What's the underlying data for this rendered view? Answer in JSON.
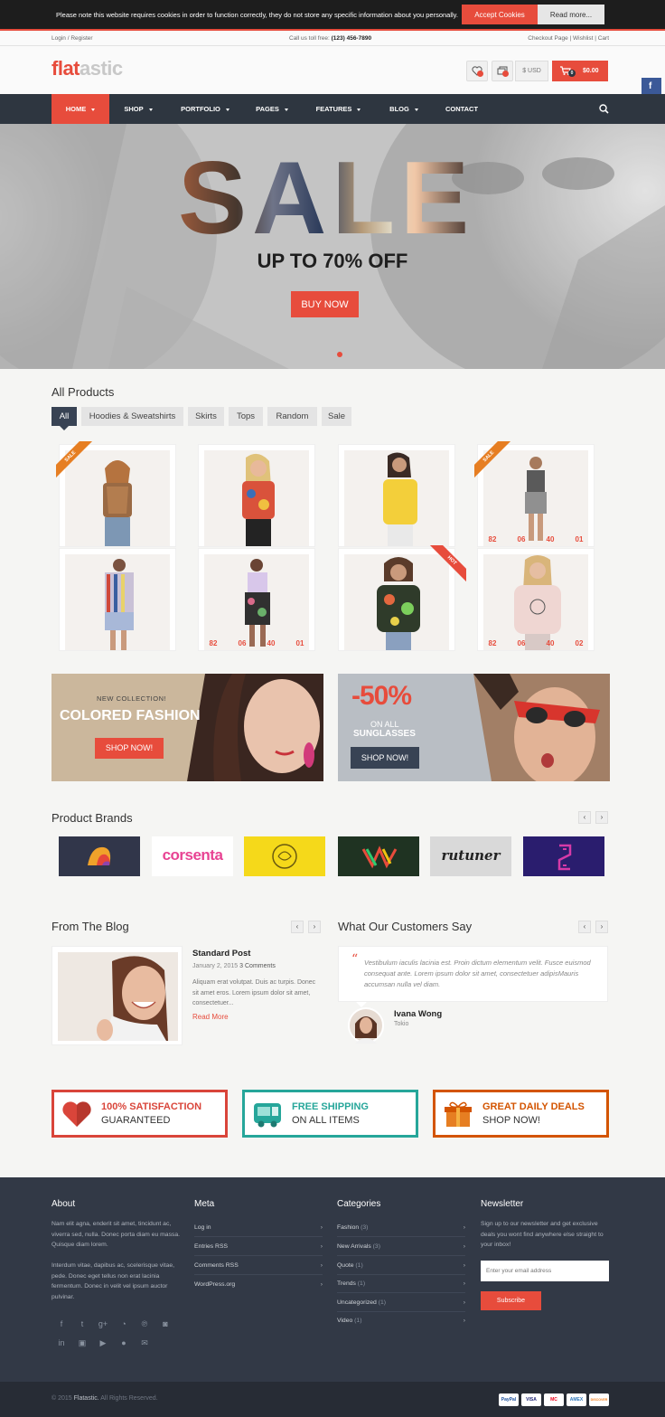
{
  "cookie": {
    "message": "Please note this website requires cookies in order to function correctly, they do not store any specific information about you personally.",
    "accept": "Accept Cookies",
    "read_more": "Read more..."
  },
  "topbar": {
    "login": "Login / Register",
    "call_label": "Call us toll free:",
    "phone": "(123) 456-7890",
    "links": "Checkout Page  |  Wishlist  |  Cart"
  },
  "header": {
    "logo_a": "flat",
    "logo_b": "astic",
    "currency": "$ USD",
    "cart_total": "$0.00",
    "cart_count": "0"
  },
  "nav": {
    "items": [
      "HOME",
      "SHOP",
      "PORTFOLIO",
      "PAGES",
      "FEATURES",
      "BLOG",
      "CONTACT"
    ]
  },
  "hero": {
    "title": "SALE",
    "subtitle": "UP TO 70% OFF",
    "button": "BUY NOW"
  },
  "products": {
    "title": "All Products",
    "filters": [
      "All",
      "Hoodies & Sweatshirts",
      "Skirts",
      "Tops",
      "Random",
      "Sale"
    ],
    "sale_label": "SALE",
    "hot_label": "HOT",
    "countdown_a": [
      "82",
      "06",
      "40",
      "01"
    ],
    "countdown_b": [
      "82",
      "06",
      "40",
      "01"
    ],
    "countdown_c": [
      "82",
      "06",
      "40",
      "02"
    ]
  },
  "banners": {
    "left_small": "NEW COLLECTION!",
    "left_big": "COLORED FASHION",
    "left_button": "SHOP NOW!",
    "right_pct": "-50%",
    "right_on": "ON ALL",
    "right_sub": "SUNGLASSES",
    "right_button": "SHOP NOW!"
  },
  "brands": {
    "title": "Product Brands",
    "names": [
      "corsenta",
      "rutuner"
    ]
  },
  "blog": {
    "title": "From The Blog",
    "post_title": "Standard Post",
    "post_date": "January 2, 2015",
    "post_comments": "3 Comments",
    "post_excerpt": "Aliquam erat volutpat. Duis ac turpis. Donec sit amet eros. Lorem ipsum dolor sit amet, consectetuer...",
    "read_more": "Read More"
  },
  "testimonials": {
    "title": "What Our Customers Say",
    "quote": "Vestibulum iaculis lacinia est. Proin dictum elementum velit. Fusce euismod consequat ante. Lorem ipsum dolor sit amet, consectetuer adipisMauris accumsan nulla vel diam.",
    "name": "Ivana Wong",
    "city": "Tokio"
  },
  "features": [
    {
      "line1": "100% SATISFACTION",
      "line2": "GUARANTEED",
      "color": "#d9453a"
    },
    {
      "line1": "FREE SHIPPING",
      "line2": "ON ALL ITEMS",
      "color": "#26a69a"
    },
    {
      "line1": "GREAT DAILY DEALS",
      "line2": "SHOP NOW!",
      "color": "#d35400"
    }
  ],
  "footer": {
    "about_title": "About",
    "about_p1": "Nam elit agna, enderit sit amet, tincidunt ac, viverra sed, nulla. Donec porta diam eu massa. Quisque diam lorem.",
    "about_p2": "Interdum vitae, dapibus ac, scelerisque vitae, pede. Donec eget tellus non erat lacinia fermentum. Donec in velit vel ipsum auctor pulvinar.",
    "meta_title": "Meta",
    "meta_links": [
      "Log in",
      "Entries RSS",
      "Comments RSS",
      "WordPress.org"
    ],
    "cat_title": "Categories",
    "categories": [
      {
        "name": "Fashion",
        "count": "(3)"
      },
      {
        "name": "New Arrivals",
        "count": "(3)"
      },
      {
        "name": "Quote",
        "count": "(1)"
      },
      {
        "name": "Trends",
        "count": "(1)"
      },
      {
        "name": "Uncategorized",
        "count": "(1)"
      },
      {
        "name": "Video",
        "count": "(1)"
      }
    ],
    "news_title": "Newsletter",
    "news_text": "Sign up to our newsletter and get exclusive deals you wont find anywhere else straight to your inbox!",
    "email_placeholder": "Enter your email address",
    "subscribe": "Subscribe"
  },
  "bottom": {
    "year": "© 2015",
    "brand": "Flatastic.",
    "rights": "All Rights Reserved.",
    "payments": [
      "PayPal",
      "VISA",
      "MC",
      "AMEX",
      "DISCOVER"
    ]
  },
  "colors": {
    "accent": "#e74c3c",
    "nav": "#2e3640",
    "footer": "#323946"
  }
}
